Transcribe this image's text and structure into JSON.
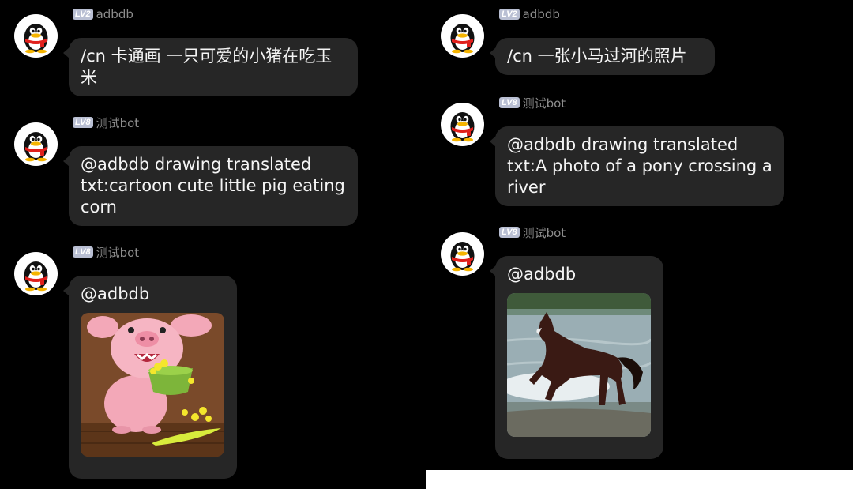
{
  "left": {
    "messages": [
      {
        "level": "LV2",
        "user": "adbdb",
        "text": "/cn 卡通画 一只可爱的小猪在吃玉米"
      },
      {
        "level": "LV8",
        "user": "测试bot",
        "text": "@adbdb  drawing translated txt:cartoon cute little pig eating corn"
      },
      {
        "level": "LV8",
        "user": "测试bot",
        "text": "@adbdb",
        "image": "cartoon-pig-image"
      }
    ]
  },
  "right": {
    "messages": [
      {
        "level": "LV2",
        "user": "adbdb",
        "text": "/cn 一张小马过河的照片"
      },
      {
        "level": "LV8",
        "user": "测试bot",
        "text": "@adbdb  drawing translated txt:A photo of a pony crossing a river"
      },
      {
        "level": "LV8",
        "user": "测试bot",
        "text": "@adbdb",
        "image": "horse-river-image"
      }
    ]
  },
  "colors": {
    "background": "#000000",
    "bubble": "#262626",
    "badge": "#b9bfd3",
    "username": "#8c8c8c",
    "text": "#f5f5f5"
  },
  "icons": {
    "avatar": "penguin-avatar-icon"
  }
}
